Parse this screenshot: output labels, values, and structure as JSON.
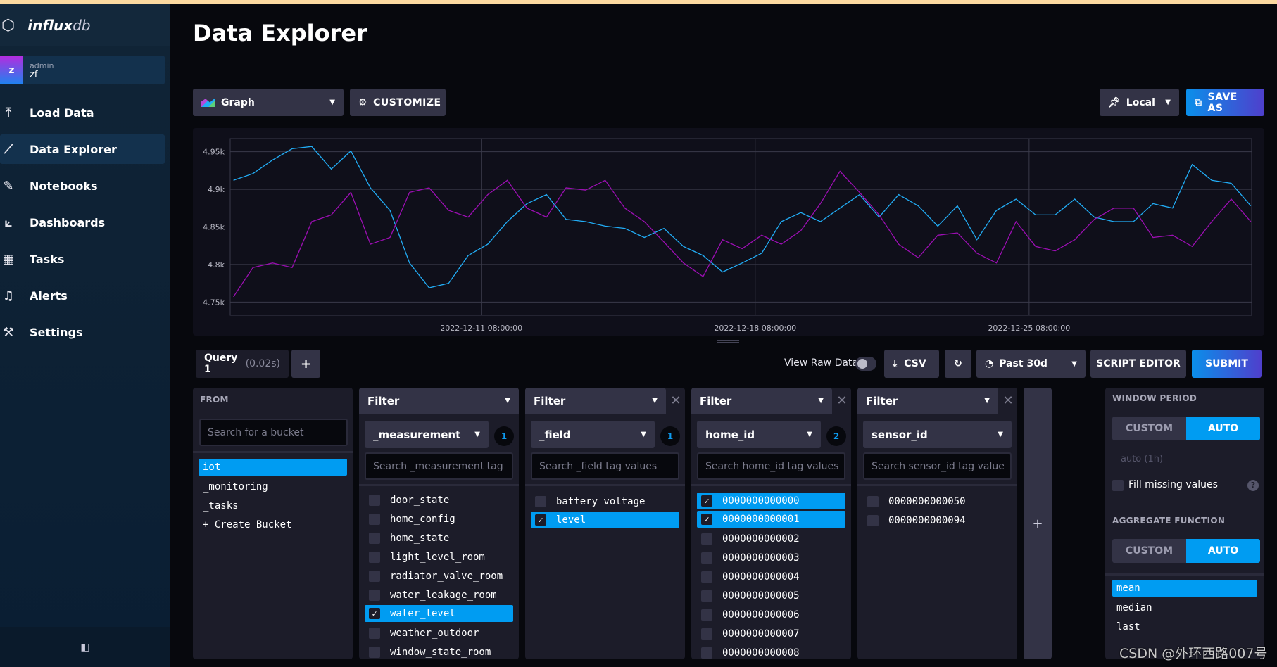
{
  "app": {
    "logo_text": "influx",
    "logo_suffix": "db"
  },
  "user": {
    "initial": "z",
    "role": "admin",
    "name": "zf"
  },
  "sidebar": {
    "items": [
      {
        "label": "Load Data",
        "icon": "upload-icon"
      },
      {
        "label": "Data Explorer",
        "icon": "graph-icon",
        "active": true
      },
      {
        "label": "Notebooks",
        "icon": "notebook-icon"
      },
      {
        "label": "Dashboards",
        "icon": "dashboard-icon"
      },
      {
        "label": "Tasks",
        "icon": "calendar-icon"
      },
      {
        "label": "Alerts",
        "icon": "bell-icon"
      },
      {
        "label": "Settings",
        "icon": "wrench-icon"
      }
    ]
  },
  "header": {
    "title": "Data Explorer"
  },
  "toolbar": {
    "vis_type": "Graph",
    "customize": "CUSTOMIZE",
    "timezone": "Local",
    "save_as": "SAVE AS"
  },
  "query_bar": {
    "tab_label": "Query 1",
    "tab_time": "(0.02s)",
    "add": "+",
    "view_raw": "View Raw Data",
    "view_raw_on": false,
    "csv": "CSV",
    "time_range": "Past 30d",
    "script_editor": "SCRIPT EDITOR",
    "submit": "SUBMIT"
  },
  "from": {
    "title": "FROM",
    "search_placeholder": "Search for a bucket",
    "buckets": [
      {
        "label": "iot",
        "selected": true
      },
      {
        "label": "_monitoring"
      },
      {
        "label": "_tasks"
      },
      {
        "label": "+ Create Bucket"
      }
    ]
  },
  "filters": [
    {
      "header": "Filter",
      "key": "_measurement",
      "count": "1",
      "placeholder": "Search _measurement tag",
      "closable": false,
      "values": [
        {
          "label": "door_state"
        },
        {
          "label": "home_config"
        },
        {
          "label": "home_state"
        },
        {
          "label": "light_level_room"
        },
        {
          "label": "radiator_valve_room"
        },
        {
          "label": "water_leakage_room"
        },
        {
          "label": "water_level",
          "selected": true
        },
        {
          "label": "weather_outdoor"
        },
        {
          "label": "window_state_room"
        }
      ]
    },
    {
      "header": "Filter",
      "key": "_field",
      "count": "1",
      "placeholder": "Search _field tag values",
      "closable": true,
      "values": [
        {
          "label": "battery_voltage"
        },
        {
          "label": "level",
          "selected": true
        }
      ]
    },
    {
      "header": "Filter",
      "key": "home_id",
      "count": "2",
      "placeholder": "Search home_id tag values",
      "closable": true,
      "values": [
        {
          "label": "0000000000000",
          "selected": true
        },
        {
          "label": "0000000000001",
          "selected": true
        },
        {
          "label": "0000000000002"
        },
        {
          "label": "0000000000003"
        },
        {
          "label": "0000000000004"
        },
        {
          "label": "0000000000005"
        },
        {
          "label": "0000000000006"
        },
        {
          "label": "0000000000007"
        },
        {
          "label": "0000000000008"
        }
      ]
    },
    {
      "header": "Filter",
      "key": "sensor_id",
      "count": "",
      "placeholder": "Search sensor_id tag value",
      "closable": true,
      "values": [
        {
          "label": "0000000000050"
        },
        {
          "label": "0000000000094"
        }
      ]
    }
  ],
  "add_filter": "+",
  "window": {
    "title": "WINDOW PERIOD",
    "custom": "CUSTOM",
    "auto": "AUTO",
    "value": "auto (1h)",
    "fill_missing": "Fill missing values",
    "fill_checked": false,
    "agg_title": "AGGREGATE FUNCTION",
    "agg_custom": "CUSTOM",
    "agg_auto": "AUTO",
    "functions": [
      {
        "label": "mean",
        "selected": true
      },
      {
        "label": "median"
      },
      {
        "label": "last"
      }
    ]
  },
  "watermark": "CSDN @外环西路007号",
  "colors": {
    "accent": "#009cf2",
    "series1": "#22adf6",
    "series2": "#9c0fb3",
    "background": "#07080d"
  },
  "chart_data": {
    "type": "line",
    "xlim": [
      "2022-12-04 22:00",
      "2022-12-31 00:30"
    ],
    "ylim": [
      4740,
      4960
    ],
    "yticks": [
      4750,
      4800,
      4850,
      4900,
      4950
    ],
    "ytick_labels": [
      "4.75k",
      "4.8k",
      "4.85k",
      "4.9k",
      "4.95k"
    ],
    "xticks": [
      "2022-12-11 08:00:00",
      "2022-12-18 08:00:00",
      "2022-12-25 08:00:00"
    ],
    "grid": true,
    "x": [
      "2022-12-05 00:00",
      "2022-12-05 12:00",
      "2022-12-06 00:00",
      "2022-12-06 12:00",
      "2022-12-07 00:00",
      "2022-12-07 12:00",
      "2022-12-08 00:00",
      "2022-12-08 12:00",
      "2022-12-09 00:00",
      "2022-12-09 12:00",
      "2022-12-10 00:00",
      "2022-12-10 12:00",
      "2022-12-11 00:00",
      "2022-12-11 12:00",
      "2022-12-12 00:00",
      "2022-12-12 12:00",
      "2022-12-13 00:00",
      "2022-12-13 12:00",
      "2022-12-14 00:00",
      "2022-12-14 12:00",
      "2022-12-15 00:00",
      "2022-12-15 12:00",
      "2022-12-16 00:00",
      "2022-12-16 12:00",
      "2022-12-17 00:00",
      "2022-12-17 12:00",
      "2022-12-18 00:00",
      "2022-12-18 12:00",
      "2022-12-19 00:00",
      "2022-12-19 12:00",
      "2022-12-20 00:00",
      "2022-12-20 12:00",
      "2022-12-21 00:00",
      "2022-12-21 12:00",
      "2022-12-22 00:00",
      "2022-12-22 12:00",
      "2022-12-23 00:00",
      "2022-12-23 12:00",
      "2022-12-24 00:00",
      "2022-12-24 12:00",
      "2022-12-25 00:00",
      "2022-12-25 12:00",
      "2022-12-26 00:00",
      "2022-12-26 12:00",
      "2022-12-27 00:00",
      "2022-12-27 12:00",
      "2022-12-28 00:00",
      "2022-12-28 12:00",
      "2022-12-29 00:00",
      "2022-12-29 12:00",
      "2022-12-30 00:00",
      "2022-12-30 12:00",
      "2022-12-31 00:00"
    ],
    "series": [
      {
        "color": "#22adf6",
        "values": [
          4912,
          4921,
          4939,
          4954,
          4957,
          4927,
          4951,
          4902,
          4872,
          4802,
          4769,
          4775,
          4812,
          4827,
          4857,
          4881,
          4893,
          4860,
          4857,
          4851,
          4848,
          4836,
          4848,
          4824,
          4812,
          4790,
          4802,
          4815,
          4857,
          4869,
          4857,
          4875,
          4893,
          4863,
          4893,
          4878,
          4851,
          4878,
          4833,
          4872,
          4887,
          4866,
          4866,
          4887,
          4863,
          4857,
          4857,
          4881,
          4875,
          4933,
          4912,
          4908,
          4878
        ]
      },
      {
        "color": "#9c0fb3",
        "values": [
          4757,
          4796,
          4802,
          4796,
          4857,
          4866,
          4896,
          4827,
          4836,
          4896,
          4902,
          4872,
          4863,
          4893,
          4912,
          4875,
          4863,
          4902,
          4899,
          4912,
          4875,
          4857,
          4830,
          4802,
          4784,
          4833,
          4821,
          4839,
          4827,
          4845,
          4881,
          4924,
          4896,
          4866,
          4827,
          4809,
          4839,
          4842,
          4815,
          4802,
          4857,
          4824,
          4818,
          4833,
          4860,
          4875,
          4875,
          4836,
          4839,
          4824,
          4857,
          4887,
          4857
        ]
      }
    ]
  }
}
